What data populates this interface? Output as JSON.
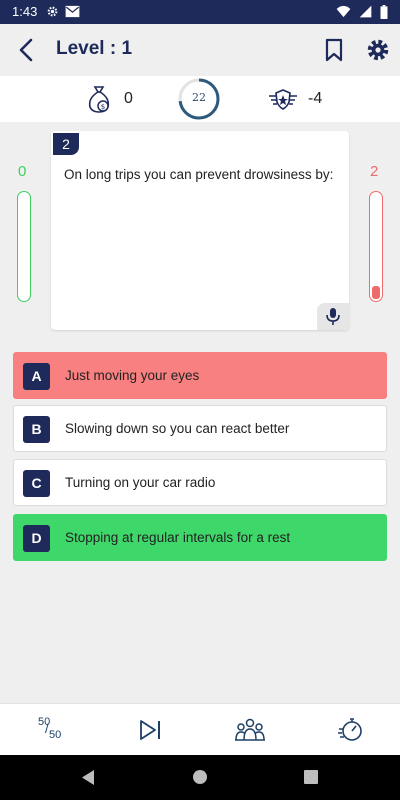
{
  "status_bar": {
    "time": "1:43"
  },
  "app_bar": {
    "title": "Level : 1"
  },
  "score_bar": {
    "coins": "0",
    "timer": "22",
    "timer_progress": 0.73,
    "penalty": "-4"
  },
  "question": {
    "number": "2",
    "text": "On long trips you can prevent drowsiness by:"
  },
  "side_counts": {
    "correct": "0",
    "wrong": "2",
    "wrong_level": 0.12
  },
  "options": [
    {
      "letter": "A",
      "text": "Just moving your eyes",
      "state": "wrong"
    },
    {
      "letter": "B",
      "text": "Slowing down so you can react better",
      "state": "normal"
    },
    {
      "letter": "C",
      "text": "Turning on your car radio",
      "state": "normal"
    },
    {
      "letter": "D",
      "text": "Stopping at regular intervals for a rest",
      "state": "correct"
    }
  ],
  "bottom_bar": {
    "fifty_top": "50",
    "fifty_bottom": "50"
  },
  "colors": {
    "primary": "#1e2a5a",
    "correct": "#3ed86a",
    "wrong": "#f88080",
    "timer_ring": "#2d5a7b"
  }
}
